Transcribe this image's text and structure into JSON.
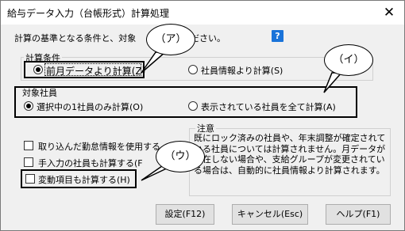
{
  "window": {
    "title": "給与データ入力（台帳形式）計算処理",
    "close": "✕"
  },
  "instruction": "計算の基準となる条件と、対象",
  "instruction_tail": "ださい。",
  "help_icon": "?",
  "calc_condition": {
    "legend": "計算条件",
    "options": [
      {
        "label": "前月データより計算(Z)",
        "selected": true
      },
      {
        "label": "社員情報より計算(S)",
        "selected": false
      }
    ]
  },
  "target_employee": {
    "legend": "対象社員",
    "options": [
      {
        "label": "選択中の1社員のみ計算(O)",
        "selected": true
      },
      {
        "label": "表示されている社員を全て計算(A)",
        "selected": false
      }
    ]
  },
  "checkboxes": [
    {
      "label": "取り込んだ勤怠情報を使用する",
      "checked": false
    },
    {
      "label": "手入力の社員も計算する(F",
      "checked": false
    },
    {
      "label": "変動項目も計算する(H)",
      "checked": false
    }
  ],
  "notes": {
    "legend": "注意",
    "text": "既にロック済みの社員や、年末調整が確定されている社員については計算されません。月データが存在しない場合や、支給グループが変更されている場合は、自動的に社員情報より計算されます。"
  },
  "buttons": {
    "settings": "設定(F12)",
    "cancel": "キャンセル(Esc)",
    "help": "ヘルプ(F1)"
  },
  "callouts": {
    "a": "（ア）",
    "i": "（イ）",
    "u": "（ウ）"
  }
}
